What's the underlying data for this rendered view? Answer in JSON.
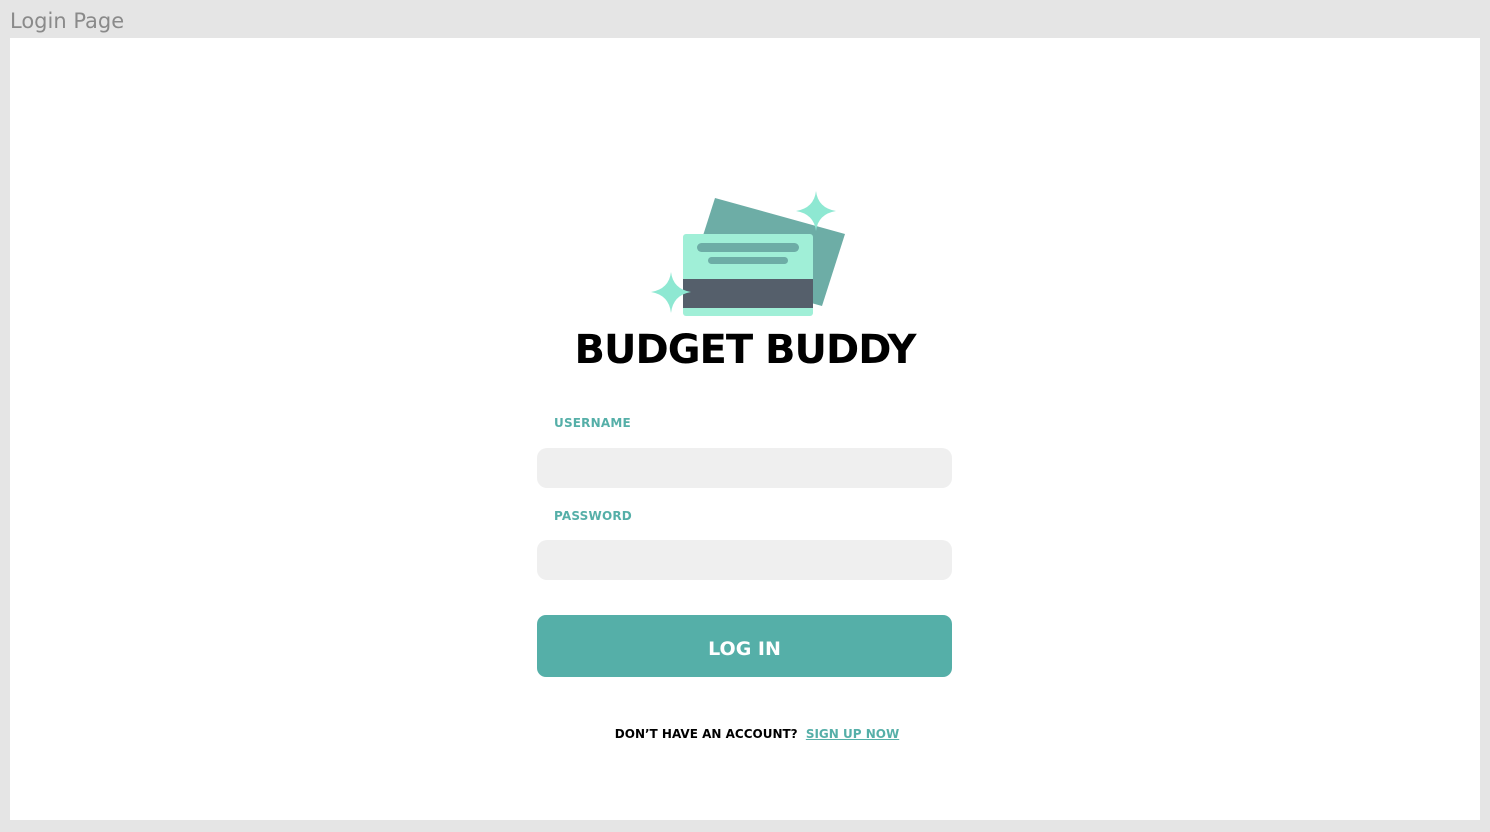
{
  "frame": {
    "title": "Login Page"
  },
  "brand": {
    "name": "BUDGET BUDDY",
    "logo_icon": "credit-cards-sparkle-icon"
  },
  "form": {
    "username_label": "USERNAME",
    "username_value": "",
    "password_label": "PASSWORD",
    "password_value": "",
    "login_label": "LOG IN"
  },
  "signup": {
    "prompt": "DON’T HAVE AN ACCOUNT?",
    "link_label": "SIGN UP NOW"
  },
  "colors": {
    "accent": "#55afa8",
    "card_light": "#a0efd7",
    "card_back": "#6dada6",
    "card_stripe": "#555f6b",
    "sparkle": "#8ee8d2",
    "input_bg": "#efefef",
    "frame_bg": "#e5e5e5"
  }
}
